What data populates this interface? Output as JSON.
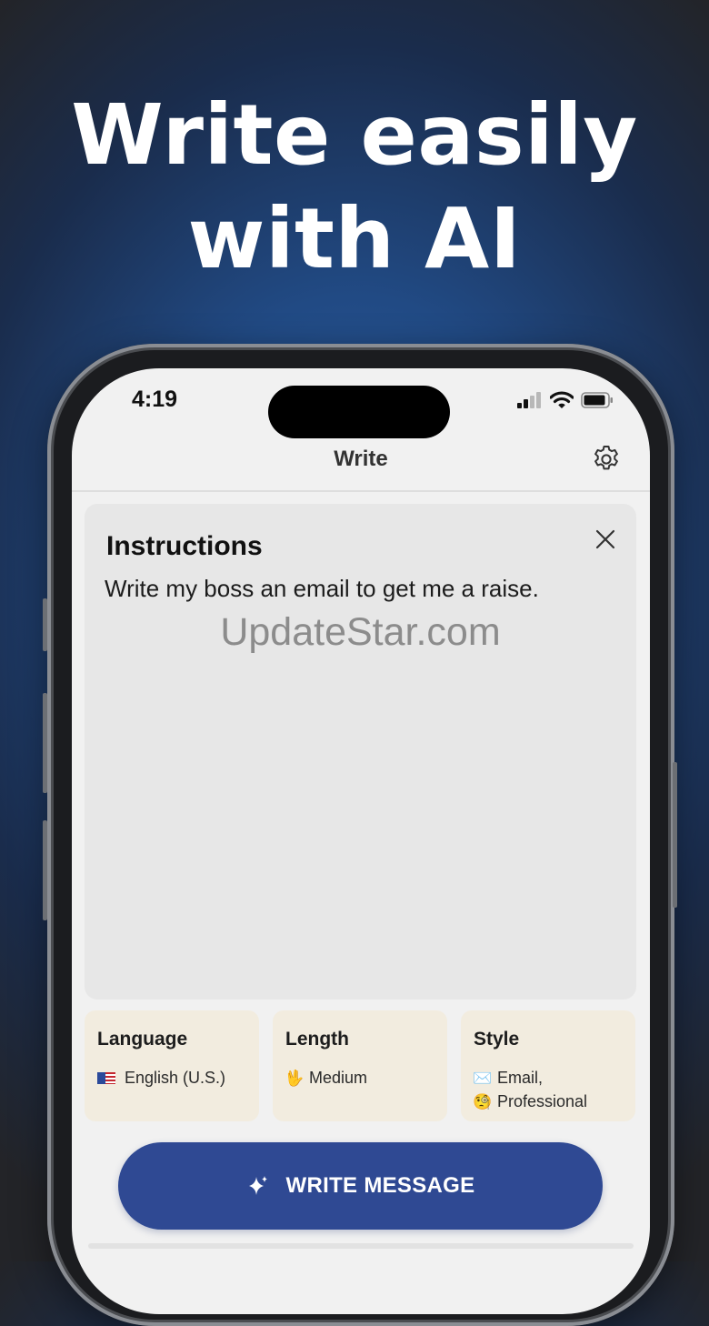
{
  "headline": {
    "line1": "Write easily",
    "line2": "with AI"
  },
  "status_bar": {
    "time": "4:19"
  },
  "nav": {
    "title": "Write",
    "settings_icon": "gear-icon"
  },
  "instructions": {
    "title": "Instructions",
    "text": "Write my boss an email to get me a raise.",
    "close_icon": "close-icon"
  },
  "watermark": "UpdateStar.com",
  "options": {
    "language": {
      "title": "Language",
      "value": "English (U.S.)",
      "icon": "us-flag-icon"
    },
    "length": {
      "title": "Length",
      "value": "Medium",
      "emoji": "🖖"
    },
    "style": {
      "title": "Style",
      "value_line1": "Email,",
      "value_line2": "Professional",
      "emoji1": "✉️",
      "emoji2": "🧐"
    }
  },
  "action": {
    "label": "WRITE MESSAGE",
    "icon": "sparkle-icon"
  },
  "colors": {
    "accent": "#2f4993",
    "option_bg": "#f2ecdf",
    "card_bg": "#e7e7e7"
  }
}
